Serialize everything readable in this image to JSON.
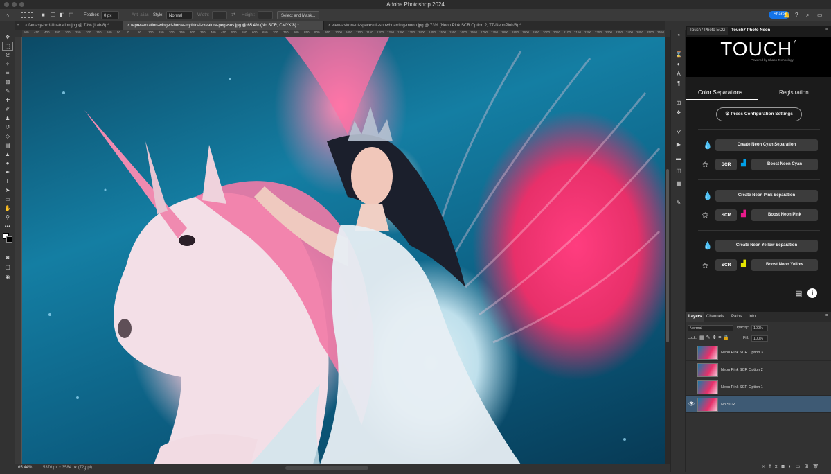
{
  "app": {
    "title": "Adobe Photoshop 2024"
  },
  "options": {
    "feather_label": "Feather:",
    "feather_value": "0 px",
    "antialias_label": "Anti-alias",
    "style_label": "Style:",
    "style_value": "Normal",
    "width_label": "Width:",
    "height_label": "Height:",
    "select_mask": "Select and Mask...",
    "share": "Share"
  },
  "tabs": [
    {
      "label": "fantasy-bird-illustration.jpg @ 73% (Lab/8) *"
    },
    {
      "label": "representation-winged-horse-mythical-creature-pegasus.jpg @ 65.4% (No SCR, CMYK/8) *"
    },
    {
      "label": "view-astronaut-spacesuit-snowboarding-moon.jpg @ 73% (Neon Pink SCR Option 2, T7-NeonPink/8) *"
    }
  ],
  "ruler": [
    "500",
    "450",
    "400",
    "350",
    "300",
    "250",
    "200",
    "150",
    "100",
    "50",
    "0",
    "50",
    "100",
    "150",
    "200",
    "250",
    "300",
    "350",
    "400",
    "450",
    "500",
    "550",
    "600",
    "650",
    "700",
    "750",
    "800",
    "850",
    "900",
    "950",
    "1000",
    "1050",
    "1100",
    "1150",
    "1200",
    "1250",
    "1300",
    "1350",
    "1400",
    "1450",
    "1500",
    "1550",
    "1600",
    "1650",
    "1700",
    "1750",
    "1800",
    "1850",
    "1900",
    "1950",
    "2000",
    "2050",
    "2100",
    "2150",
    "2200",
    "2250",
    "2300",
    "2350",
    "2400",
    "2450",
    "2500",
    "2550"
  ],
  "status": {
    "zoom": "65.44%",
    "dims": "5376 px x 3584 px (72 ppi)"
  },
  "panel": {
    "tab1": "Touch7 Photo ECG",
    "tab2": "Touch7 Photo Neon",
    "logo_text": "TOUCH",
    "logo_sup": "7",
    "logo_sub": "Powered by Khaos Technology",
    "subtab_color": "Color Separations",
    "subtab_reg": "Registration",
    "config": "Press Configuration Settings",
    "cyan": {
      "create": "Create Neon Cyan Separation",
      "scr": "SCR",
      "boost": "Boost Neon Cyan",
      "color": "#00a0e9"
    },
    "pink": {
      "create": "Create Neon Pink Separation",
      "scr": "SCR",
      "boost": "Boost Neon Pink",
      "color": "#e8198b"
    },
    "yellow": {
      "create": "Create Neon Yellow Separation",
      "scr": "SCR",
      "boost": "Boost Neon Yellow",
      "color": "#e6e600"
    }
  },
  "layers": {
    "tabs": [
      "Layers",
      "Channels",
      "Paths",
      "Info"
    ],
    "blend": "Normal",
    "opacity_label": "Opacity:",
    "opacity": "100%",
    "lock_label": "Lock:",
    "fill_label": "Fill:",
    "fill": "100%",
    "items": [
      {
        "name": "Neon Pink SCR Option 3"
      },
      {
        "name": "Neon Pink SCR Option 2"
      },
      {
        "name": "Neon Pink SCR Option 1"
      },
      {
        "name": "No SCR"
      }
    ]
  }
}
